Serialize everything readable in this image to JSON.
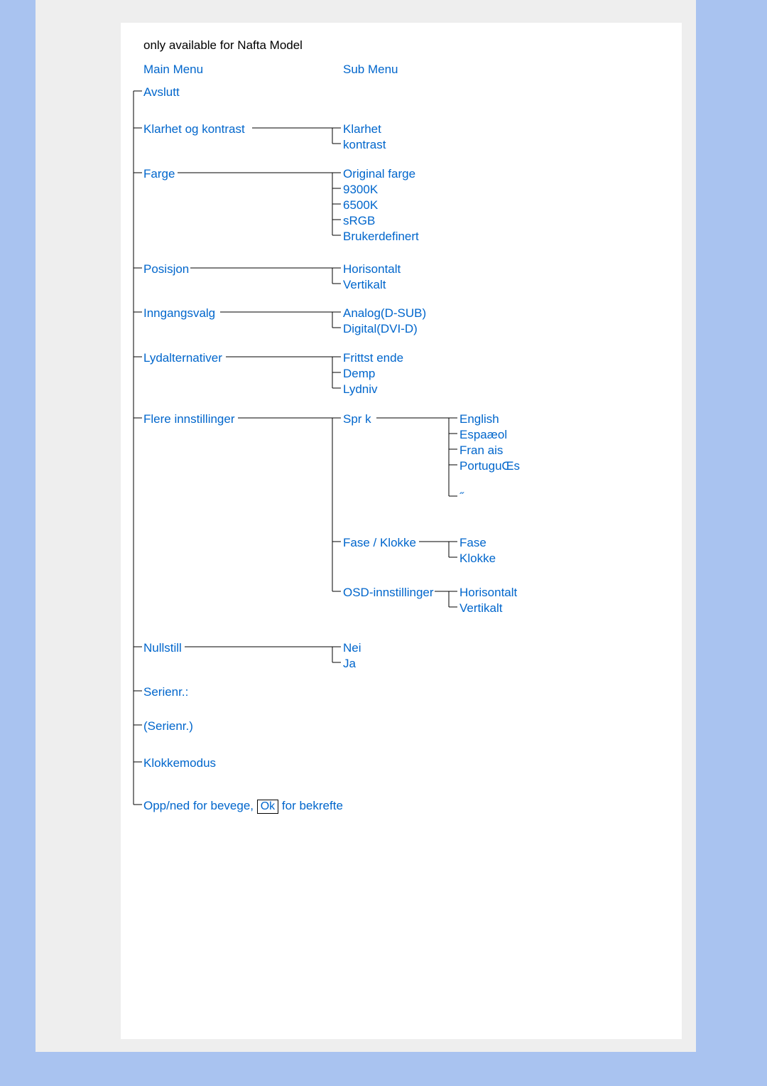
{
  "header": {
    "note": "only available for Nafta Model",
    "main_menu": "Main Menu",
    "sub_menu": "Sub Menu"
  },
  "main": {
    "avslutt": "Avslutt",
    "klarhet_og_kontrast": "Klarhet og kontrast",
    "farge": "Farge",
    "posisjon": "Posisjon",
    "inngangsvalg": "Inngangsvalg",
    "lydalternativer": "Lydalternativer",
    "flere_innstillinger": "Flere innstillinger",
    "nullstill": "Nullstill",
    "serienr_label": "Serienr.:",
    "serienr_paren": "(Serienr.)",
    "klokkemodus": "Klokkemodus",
    "instr_pre": "Opp/ned for  bevege, ",
    "instr_ok": "Ok",
    "instr_post": " for  bekrefte"
  },
  "sub": {
    "klarhet": "Klarhet",
    "kontrast": "kontrast",
    "original_farge": "Original farge",
    "c9300k": "9300K",
    "c6500k": "6500K",
    "srgb": "sRGB",
    "brukerdefinert": "Brukerdefinert",
    "horisontalt": "Horisontalt",
    "vertikalt": "Vertikalt",
    "analog": "Analog(D-SUB)",
    "digital": "Digital(DVI-D)",
    "frittst_ende": "Frittst ende",
    "demp": "Demp",
    "lydniv": "Lydniv",
    "sprk": "Spr k",
    "fase_klokke": "Fase / Klokke",
    "osd_innstillinger": "OSD-innstillinger",
    "nei": "Nei",
    "ja": "Ja"
  },
  "lang": {
    "english": "English",
    "espanol": "Espaæol",
    "francais": "Fran ais",
    "portugues": "PortuguŒs",
    "extra": "˝"
  },
  "fk": {
    "fase": "Fase",
    "klokke": "Klokke"
  },
  "osd": {
    "horisontalt": "Horisontalt",
    "vertikalt": "Vertikalt"
  }
}
